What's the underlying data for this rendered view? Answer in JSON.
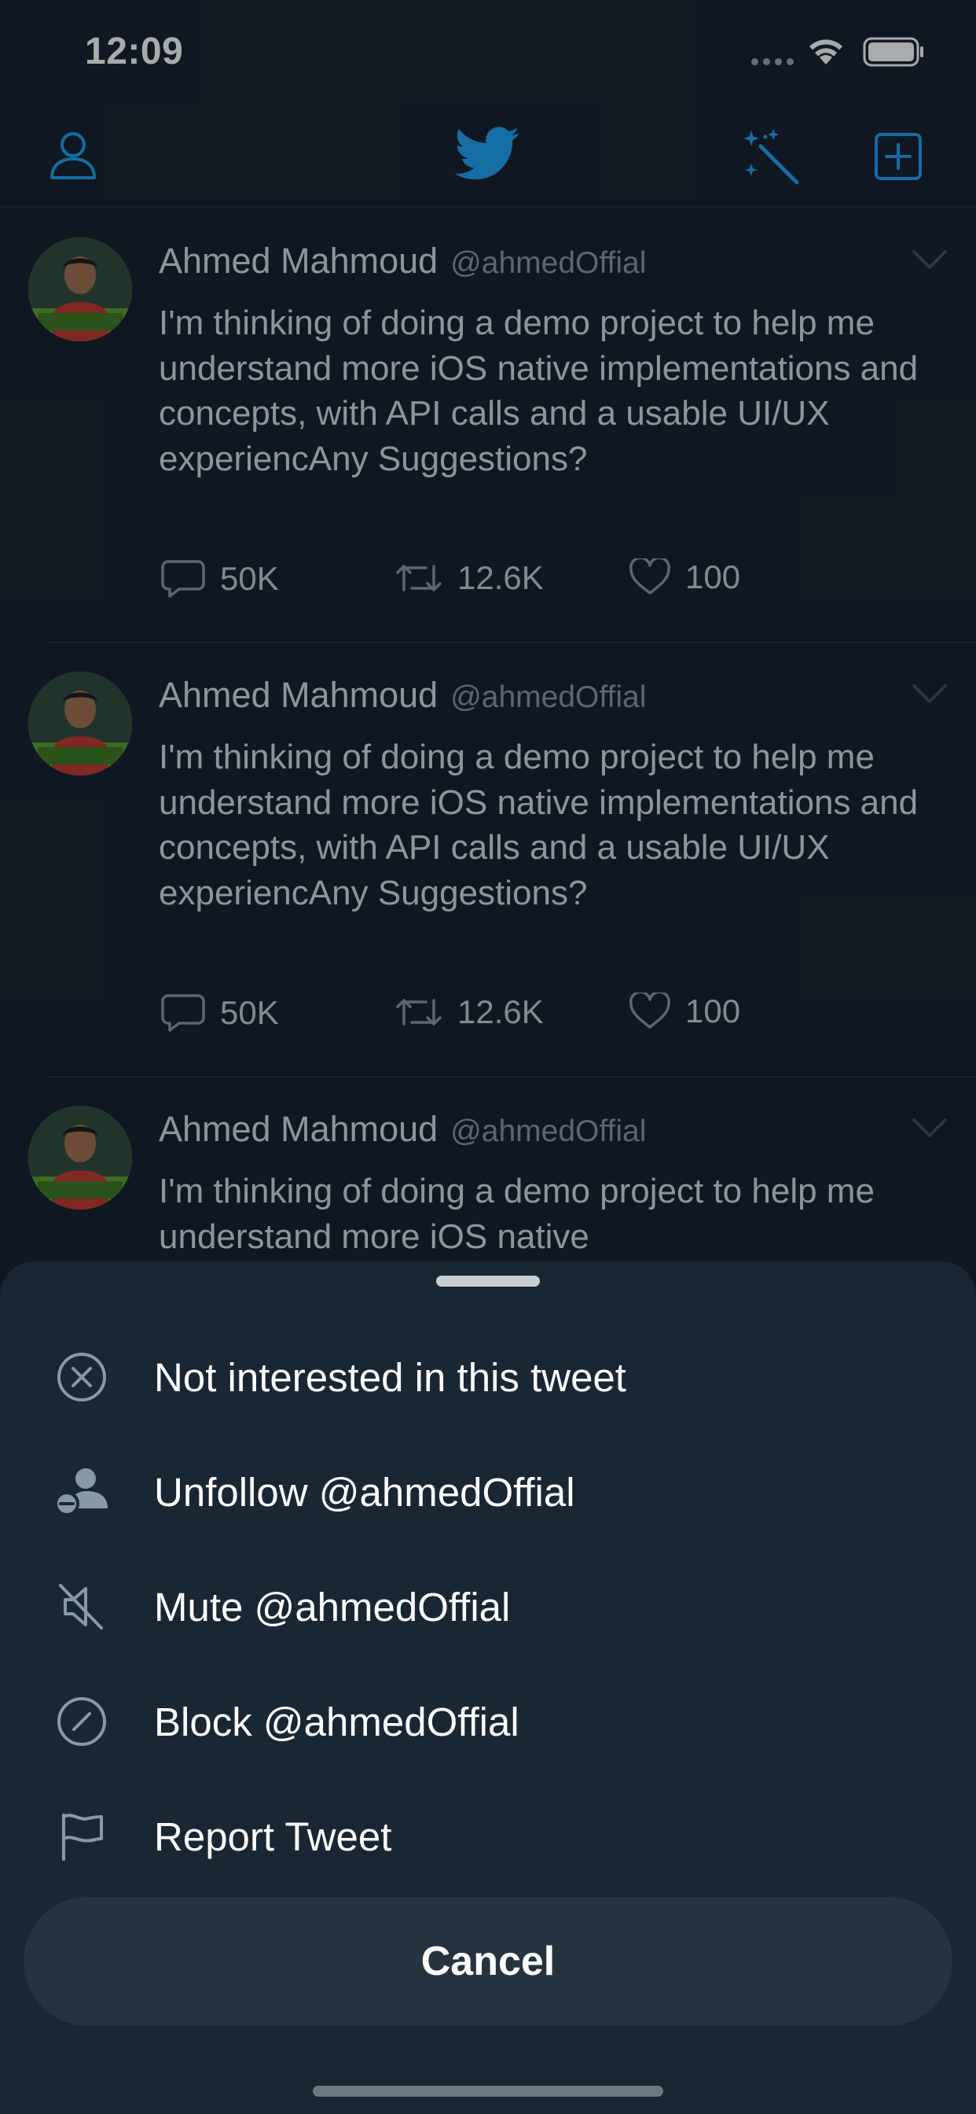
{
  "status_bar": {
    "time": "12:09"
  },
  "nav": {
    "profile_icon": "profile-icon",
    "logo_icon": "twitter-bird-icon",
    "sparkle_icon": "sparkle-icon",
    "compose_icon": "compose-icon",
    "accent_color": "#1da1f2"
  },
  "tweets": [
    {
      "name": "Ahmed Mahmoud",
      "handle": "@ahmedOffial",
      "text": "I'm thinking of doing a demo project to help me understand more iOS native implementations and concepts, with API calls and a usable UI/UX experiencAny Suggestions?",
      "replies": "50K",
      "retweets": "12.6K",
      "likes": "100"
    },
    {
      "name": "Ahmed Mahmoud",
      "handle": "@ahmedOffial",
      "text": "I'm thinking of doing a demo project to help me understand more iOS native implementations and concepts, with API calls and a usable UI/UX experiencAny Suggestions?",
      "replies": "50K",
      "retweets": "12.6K",
      "likes": "100"
    },
    {
      "name": "Ahmed Mahmoud",
      "handle": "@ahmedOffial",
      "text": "I'm thinking of doing a demo project to help me understand more iOS native",
      "replies": "",
      "retweets": "",
      "likes": ""
    }
  ],
  "sheet": {
    "items": [
      {
        "label": "Not interested in this tweet",
        "icon": "close-circle-icon"
      },
      {
        "label": "Unfollow @ahmedOffial",
        "icon": "unfollow-icon"
      },
      {
        "label": "Mute @ahmedOffial",
        "icon": "mute-icon"
      },
      {
        "label": "Block @ahmedOffial",
        "icon": "block-icon"
      },
      {
        "label": "Report Tweet",
        "icon": "flag-icon"
      }
    ],
    "cancel_label": "Cancel"
  },
  "colors": {
    "background": "#15202b",
    "sheet": "#192734",
    "cancel_button": "#253341",
    "secondary_text": "#8899a6"
  }
}
